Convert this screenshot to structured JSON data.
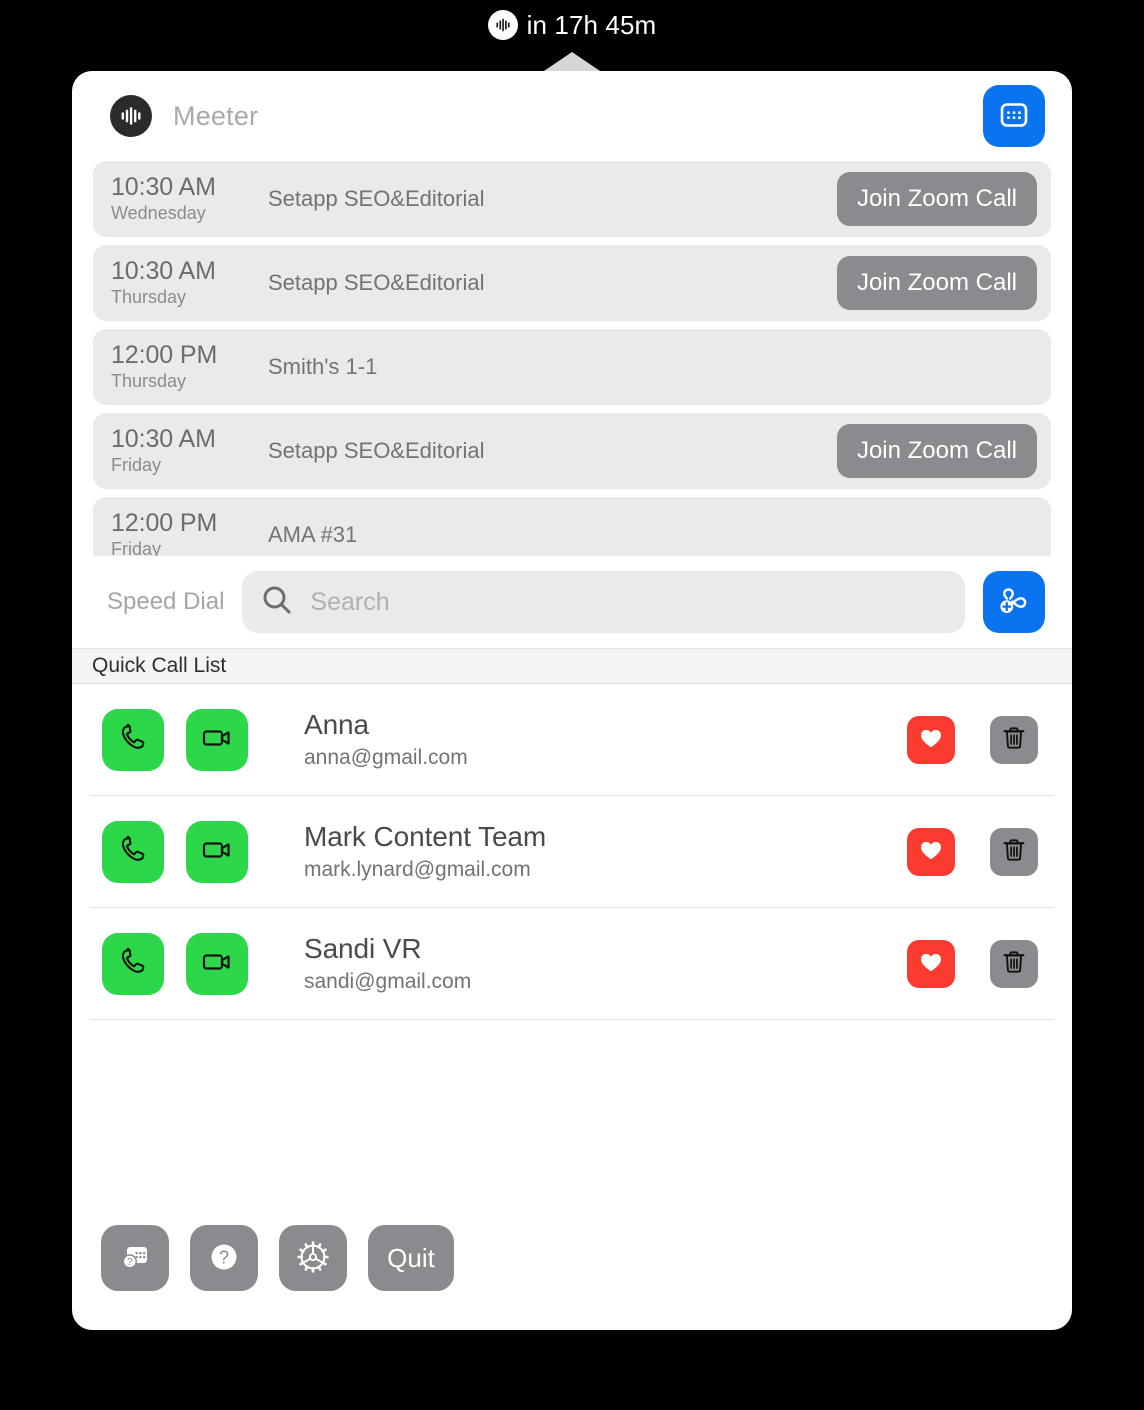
{
  "menubar": {
    "icon": "meeter-waveform-icon",
    "countdown": "in 17h 45m"
  },
  "header": {
    "logo_icon": "meeter-waveform-icon",
    "app_name": "Meeter",
    "calendar_button_icon": "calendar-icon"
  },
  "meetings": [
    {
      "time": "10:30 AM",
      "day": "Wednesday",
      "title": "Setapp SEO&Editorial",
      "action_label": "Join Zoom Call",
      "has_action": true
    },
    {
      "time": "10:30 AM",
      "day": "Thursday",
      "title": "Setapp SEO&Editorial",
      "action_label": "Join Zoom Call",
      "has_action": true
    },
    {
      "time": "12:00 PM",
      "day": "Thursday",
      "title": "Smith's 1-1",
      "action_label": "",
      "has_action": false
    },
    {
      "time": "10:30 AM",
      "day": "Friday",
      "title": "Setapp SEO&Editorial",
      "action_label": "Join Zoom Call",
      "has_action": true
    },
    {
      "time": "12:00 PM",
      "day": "Friday",
      "title": "AMA #31",
      "action_label": "",
      "has_action": false
    }
  ],
  "speed_dial": {
    "label": "Speed Dial",
    "search_placeholder": "Search",
    "search_value": "",
    "search_icon": "search-icon",
    "add_contact_icon": "add-call-icon"
  },
  "quick_call_list": {
    "header": "Quick Call List",
    "contacts": [
      {
        "name": "Anna",
        "email": "anna@gmail.com",
        "call_icon": "phone-icon",
        "video_icon": "video-camera-icon",
        "favorite_icon": "heart-icon",
        "delete_icon": "trash-icon"
      },
      {
        "name": "Mark Content Team",
        "email": "mark.lynard@gmail.com",
        "call_icon": "phone-icon",
        "video_icon": "video-camera-icon",
        "favorite_icon": "heart-icon",
        "delete_icon": "trash-icon"
      },
      {
        "name": "Sandi VR",
        "email": "sandi@gmail.com",
        "call_icon": "phone-icon",
        "video_icon": "video-camera-icon",
        "favorite_icon": "heart-icon",
        "delete_icon": "trash-icon"
      }
    ]
  },
  "toolbar": {
    "calendar_help_icon": "calendar-help-icon",
    "help_icon": "question-mark-icon",
    "settings_icon": "gear-icon",
    "quit_label": "Quit"
  },
  "colors": {
    "accent_blue": "#0a74f0",
    "call_green": "#2cd84a",
    "favorite_red": "#fc3b30",
    "neutral_gray": "#8a8a8f",
    "row_gray": "#eaeaea",
    "background": "#000000",
    "panel": "#ffffff"
  }
}
